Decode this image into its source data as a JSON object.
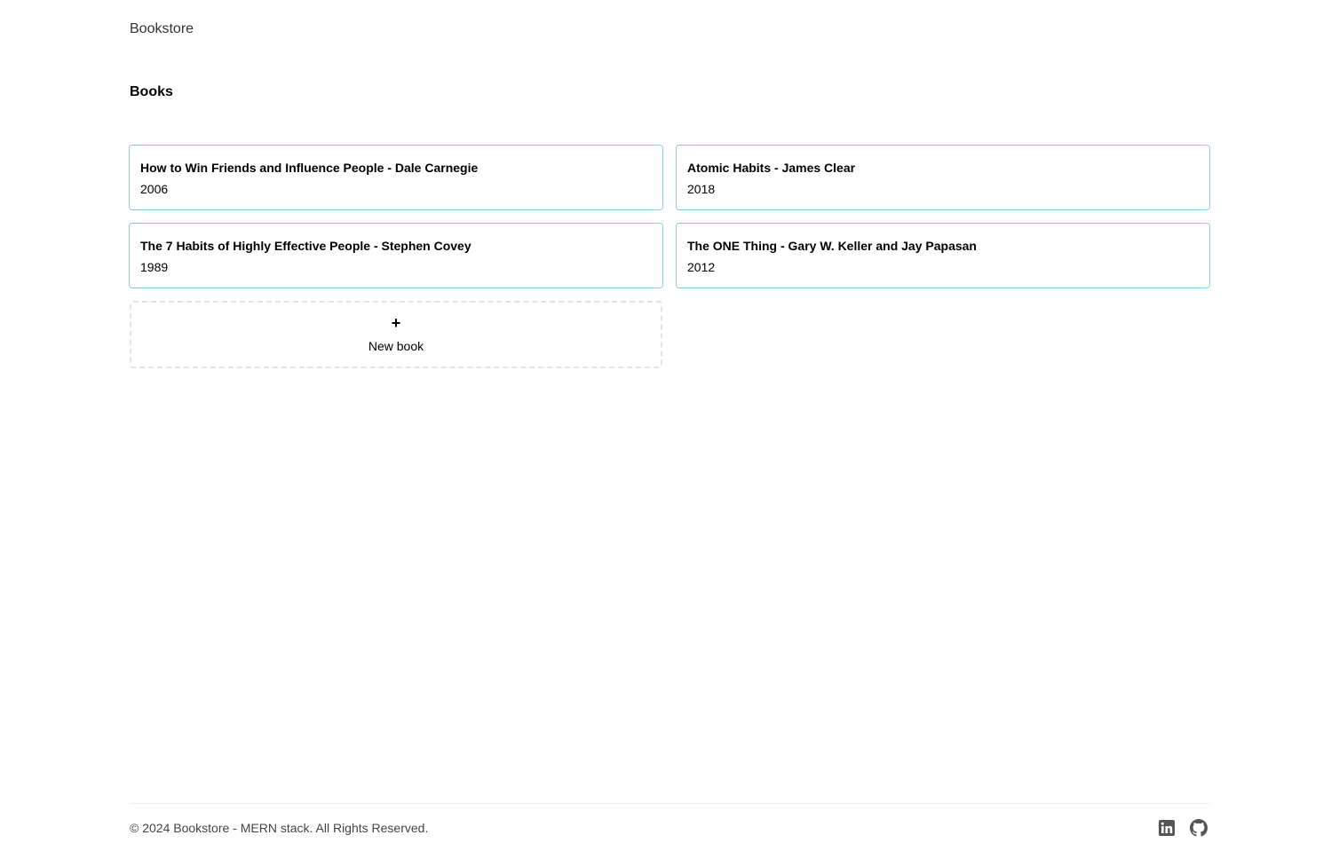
{
  "navbar": {
    "brand": "Bookstore"
  },
  "main": {
    "title": "Books",
    "books": [
      {
        "title": "How to Win Friends and Influence People - Dale Carnegie",
        "year": "2006"
      },
      {
        "title": "Atomic Habits - James Clear",
        "year": "2018"
      },
      {
        "title": "The 7 Habits of Highly Effective People - Stephen Covey",
        "year": "1989"
      },
      {
        "title": "The ONE Thing - Gary W. Keller and Jay Papasan",
        "year": "2012"
      }
    ],
    "new_book": {
      "icon": "+",
      "label": "New book"
    }
  },
  "footer": {
    "copyright": "© 2024 Bookstore - MERN stack. All Rights Reserved.",
    "icons": [
      "linkedin-icon",
      "github-icon"
    ]
  },
  "colors": {
    "card_border": "#8ecae6",
    "dashed_border": "#e3e3e3",
    "footer_text": "#444444",
    "icon": "#555555"
  }
}
